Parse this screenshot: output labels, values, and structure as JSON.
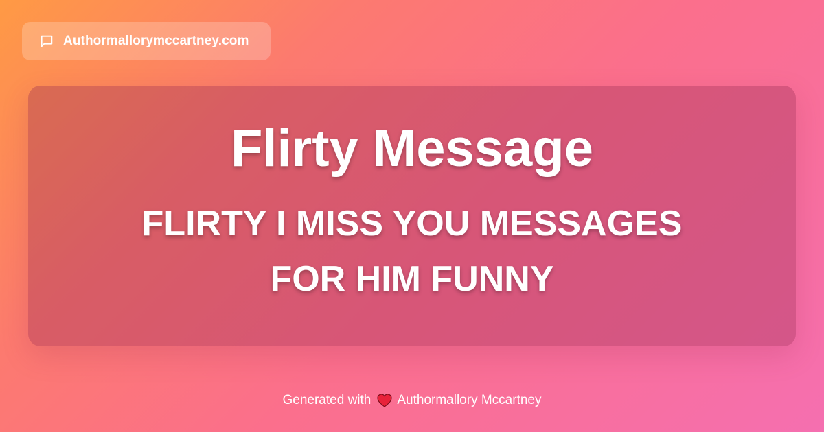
{
  "site_badge": {
    "icon": "chat-bubble-icon",
    "domain": "Authormallorymccartney.com"
  },
  "card": {
    "title": "Flirty Message",
    "subtitle": "FLIRTY I MISS YOU MESSAGES FOR HIM FUNNY"
  },
  "footer": {
    "prefix": "Generated with",
    "icon": "heart-icon",
    "author": "Authormallory Mccartney"
  },
  "colors": {
    "gradient_start": "#ff9a44",
    "gradient_end": "#f56fb0",
    "heart": "#e8223a",
    "text": "#ffffff"
  }
}
